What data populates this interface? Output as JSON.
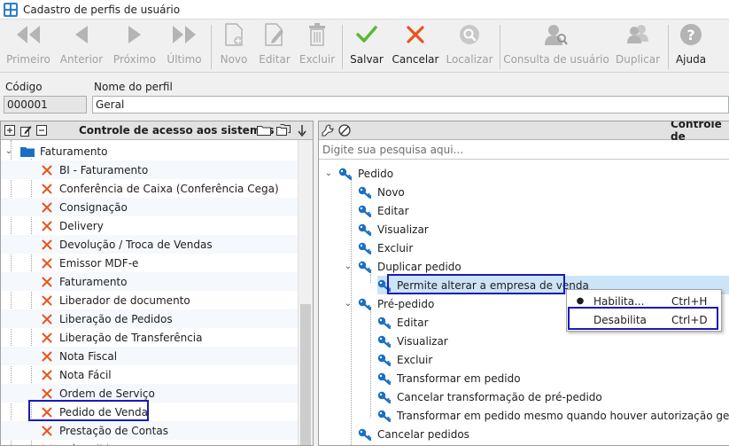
{
  "window": {
    "title": "Cadastro de perfis de usuário"
  },
  "toolbar": {
    "buttons": [
      {
        "label": "Primeiro",
        "enabled": false
      },
      {
        "label": "Anterior",
        "enabled": false
      },
      {
        "label": "Próximo",
        "enabled": false
      },
      {
        "label": "Último",
        "enabled": false
      },
      {
        "label": "Novo",
        "enabled": false
      },
      {
        "label": "Editar",
        "enabled": false
      },
      {
        "label": "Excluir",
        "enabled": false
      },
      {
        "label": "Salvar",
        "enabled": true
      },
      {
        "label": "Cancelar",
        "enabled": true
      },
      {
        "label": "Localizar",
        "enabled": false
      },
      {
        "label": "Consulta de usuário",
        "enabled": false
      },
      {
        "label": "Duplicar",
        "enabled": false
      },
      {
        "label": "Ajuda",
        "enabled": true
      }
    ]
  },
  "fields": {
    "code_label": "Código",
    "code_value": "000001",
    "name_label": "Nome do perfil",
    "name_value": "Geral"
  },
  "left_panel": {
    "title": "Controle de acesso aos sistemas",
    "group": "Faturamento",
    "items": [
      "BI - Faturamento",
      "Conferência de Caixa (Conferência Cega)",
      "Consignação",
      "Delivery",
      "Devolução / Troca de Vendas",
      "Emissor MDF-e",
      "Faturamento",
      "Liberador de documento",
      "Liberação de Pedidos",
      "Liberação de Transferência",
      "Nota Fiscal",
      "Nota Fácil",
      "Ordem de Serviço",
      "Pedido de Venda",
      "Prestação de Contas",
      "Pré-Pedido"
    ]
  },
  "right_panel": {
    "title": "Controle de",
    "search_placeholder": "Digite sua pesquisa aqui...",
    "tree": {
      "pedido": "Pedido",
      "novo": "Novo",
      "editar": "Editar",
      "visualizar": "Visualizar",
      "excluir": "Excluir",
      "duplicar": "Duplicar pedido",
      "permite": "Permite alterar a empresa de venda",
      "pre_pedido": "Pré-pedido",
      "pp_editar": "Editar",
      "pp_visualizar": "Visualizar",
      "pp_excluir": "Excluir",
      "pp_transformar": "Transformar em pedido",
      "pp_cancelar": "Cancelar transformação de pré-pedido",
      "pp_transformar_aut": "Transformar em pedido mesmo quando houver autorização gerencial p",
      "cancelar_pedidos": "Cancelar pedidos"
    }
  },
  "context_menu": {
    "items": [
      {
        "label": "Habilita...",
        "shortcut": "Ctrl+H"
      },
      {
        "label": "Desabilita",
        "shortcut": "Ctrl+D"
      }
    ]
  },
  "colors": {
    "accent_blue": "#1a6fc4",
    "highlight_border": "#1a1ab8",
    "x_red": "#e8541c",
    "save_green": "#5cb82e",
    "cancel_red": "#e8541c"
  }
}
